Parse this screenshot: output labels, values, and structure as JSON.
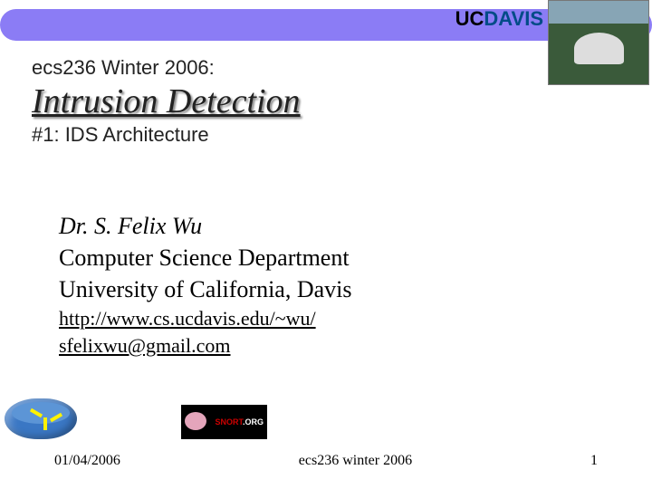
{
  "logo": {
    "uc": "UC",
    "davis": "DAVIS"
  },
  "header": {
    "course": "ecs236 Winter 2006:",
    "title": "Intrusion Detection",
    "subtitle": "#1: IDS Architecture"
  },
  "author": {
    "name": "Dr. S. Felix Wu",
    "dept": "Computer Science Department",
    "university": "University of California, Davis",
    "url": "http://www.cs.ucdavis.edu/~wu/",
    "email": "sfelixwu@gmail.com"
  },
  "snort": {
    "main": "SNORT",
    "org": ".ORG"
  },
  "footer": {
    "date": "01/04/2006",
    "center": "ecs236 winter 2006",
    "page": "1"
  }
}
